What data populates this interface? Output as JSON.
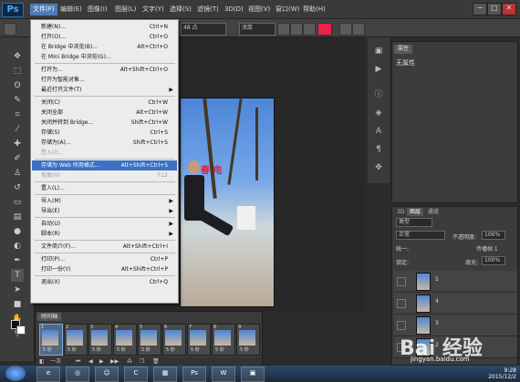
{
  "app": {
    "logo": "Ps"
  },
  "menubar": {
    "items": [
      "文件(F)",
      "编辑(E)",
      "图像(I)",
      "图层(L)",
      "文字(Y)",
      "选择(S)",
      "滤镜(T)",
      "3D(D)",
      "视图(V)",
      "窗口(W)",
      "帮助(H)"
    ],
    "active_index": 0,
    "window_buttons": [
      "─",
      "□",
      "✕"
    ]
  },
  "optbar": {
    "font_size": "48 点",
    "anti_alias": "浑厚",
    "text_color_hex": "#e8224a"
  },
  "file_menu": [
    {
      "label": "新建(N)...",
      "shortcut": "Ctrl+N"
    },
    {
      "label": "打开(O)...",
      "shortcut": "Ctrl+O"
    },
    {
      "label": "在 Bridge 中浏览(B)...",
      "shortcut": "Alt+Ctrl+O"
    },
    {
      "label": "在 Mini Bridge 中浏览(G)...",
      "shortcut": ""
    },
    {
      "label": "打开为...",
      "shortcut": "Alt+Shift+Ctrl+O"
    },
    {
      "label": "打开为智能对象...",
      "shortcut": ""
    },
    {
      "label": "最近打开文件(T)",
      "shortcut": "",
      "submenu": true
    },
    {
      "label": "关闭(C)",
      "shortcut": "Ctrl+W"
    },
    {
      "label": "关闭全部",
      "shortcut": "Alt+Ctrl+W"
    },
    {
      "label": "关闭并转到 Bridge...",
      "shortcut": "Shift+Ctrl+W"
    },
    {
      "label": "存储(S)",
      "shortcut": "Ctrl+S"
    },
    {
      "label": "存储为(A)...",
      "shortcut": "Shift+Ctrl+S"
    },
    {
      "label": "签入(I)...",
      "shortcut": "",
      "disabled": true
    },
    {
      "label": "存储为 Web 所用格式...",
      "shortcut": "Alt+Shift+Ctrl+S",
      "highlighted": true
    },
    {
      "label": "恢复(V)",
      "shortcut": "F12",
      "disabled": true
    },
    {
      "label": "置入(L)...",
      "shortcut": ""
    },
    {
      "label": "导入(M)",
      "shortcut": "",
      "submenu": true
    },
    {
      "label": "导出(E)",
      "shortcut": "",
      "submenu": true
    },
    {
      "label": "自动(U)",
      "shortcut": "",
      "submenu": true
    },
    {
      "label": "脚本(R)",
      "shortcut": "",
      "submenu": true
    },
    {
      "label": "文件简介(F)...",
      "shortcut": "Alt+Shift+Ctrl+I"
    },
    {
      "label": "打印(P)...",
      "shortcut": "Ctrl+P"
    },
    {
      "label": "打印一份(Y)",
      "shortcut": "Alt+Shift+Ctrl+P"
    },
    {
      "label": "退出(X)",
      "shortcut": "Ctrl+Q"
    }
  ],
  "canvas": {
    "overlay_text": "春 电"
  },
  "properties": {
    "tab": "属性",
    "content": "无属性"
  },
  "layers": {
    "tabs": [
      "3D",
      "图层",
      "通道"
    ],
    "filter": "类型",
    "blend_mode": "正常",
    "opacity_label": "不透明度:",
    "opacity_value": "100%",
    "unify_label": "统一:",
    "propagate_label": "传播帧 1",
    "lock_label": "锁定:",
    "fill_label": "填充:",
    "fill_value": "100%",
    "rows": [
      "5",
      "4",
      "3",
      "2"
    ]
  },
  "timeline": {
    "tab": "时间轴",
    "frames": [
      {
        "num": "1",
        "dur": "5 秒"
      },
      {
        "num": "2",
        "dur": "5 秒"
      },
      {
        "num": "3",
        "dur": "5 秒"
      },
      {
        "num": "4",
        "dur": "5 秒"
      },
      {
        "num": "5",
        "dur": "5 秒"
      },
      {
        "num": "6",
        "dur": "5 秒"
      },
      {
        "num": "7",
        "dur": "5 秒"
      },
      {
        "num": "8",
        "dur": "5 秒"
      },
      {
        "num": "9",
        "dur": "5 秒"
      }
    ],
    "loop": "一次"
  },
  "taskbar": {
    "clock_time": "9:28",
    "clock_date": "2015/12/2",
    "apps": [
      "e",
      "◎",
      "☺",
      "C",
      "▦",
      "Ps",
      "W",
      "▣"
    ]
  },
  "watermark": {
    "logo": "Bai 经验",
    "url": "jingyan.baidu.com"
  }
}
